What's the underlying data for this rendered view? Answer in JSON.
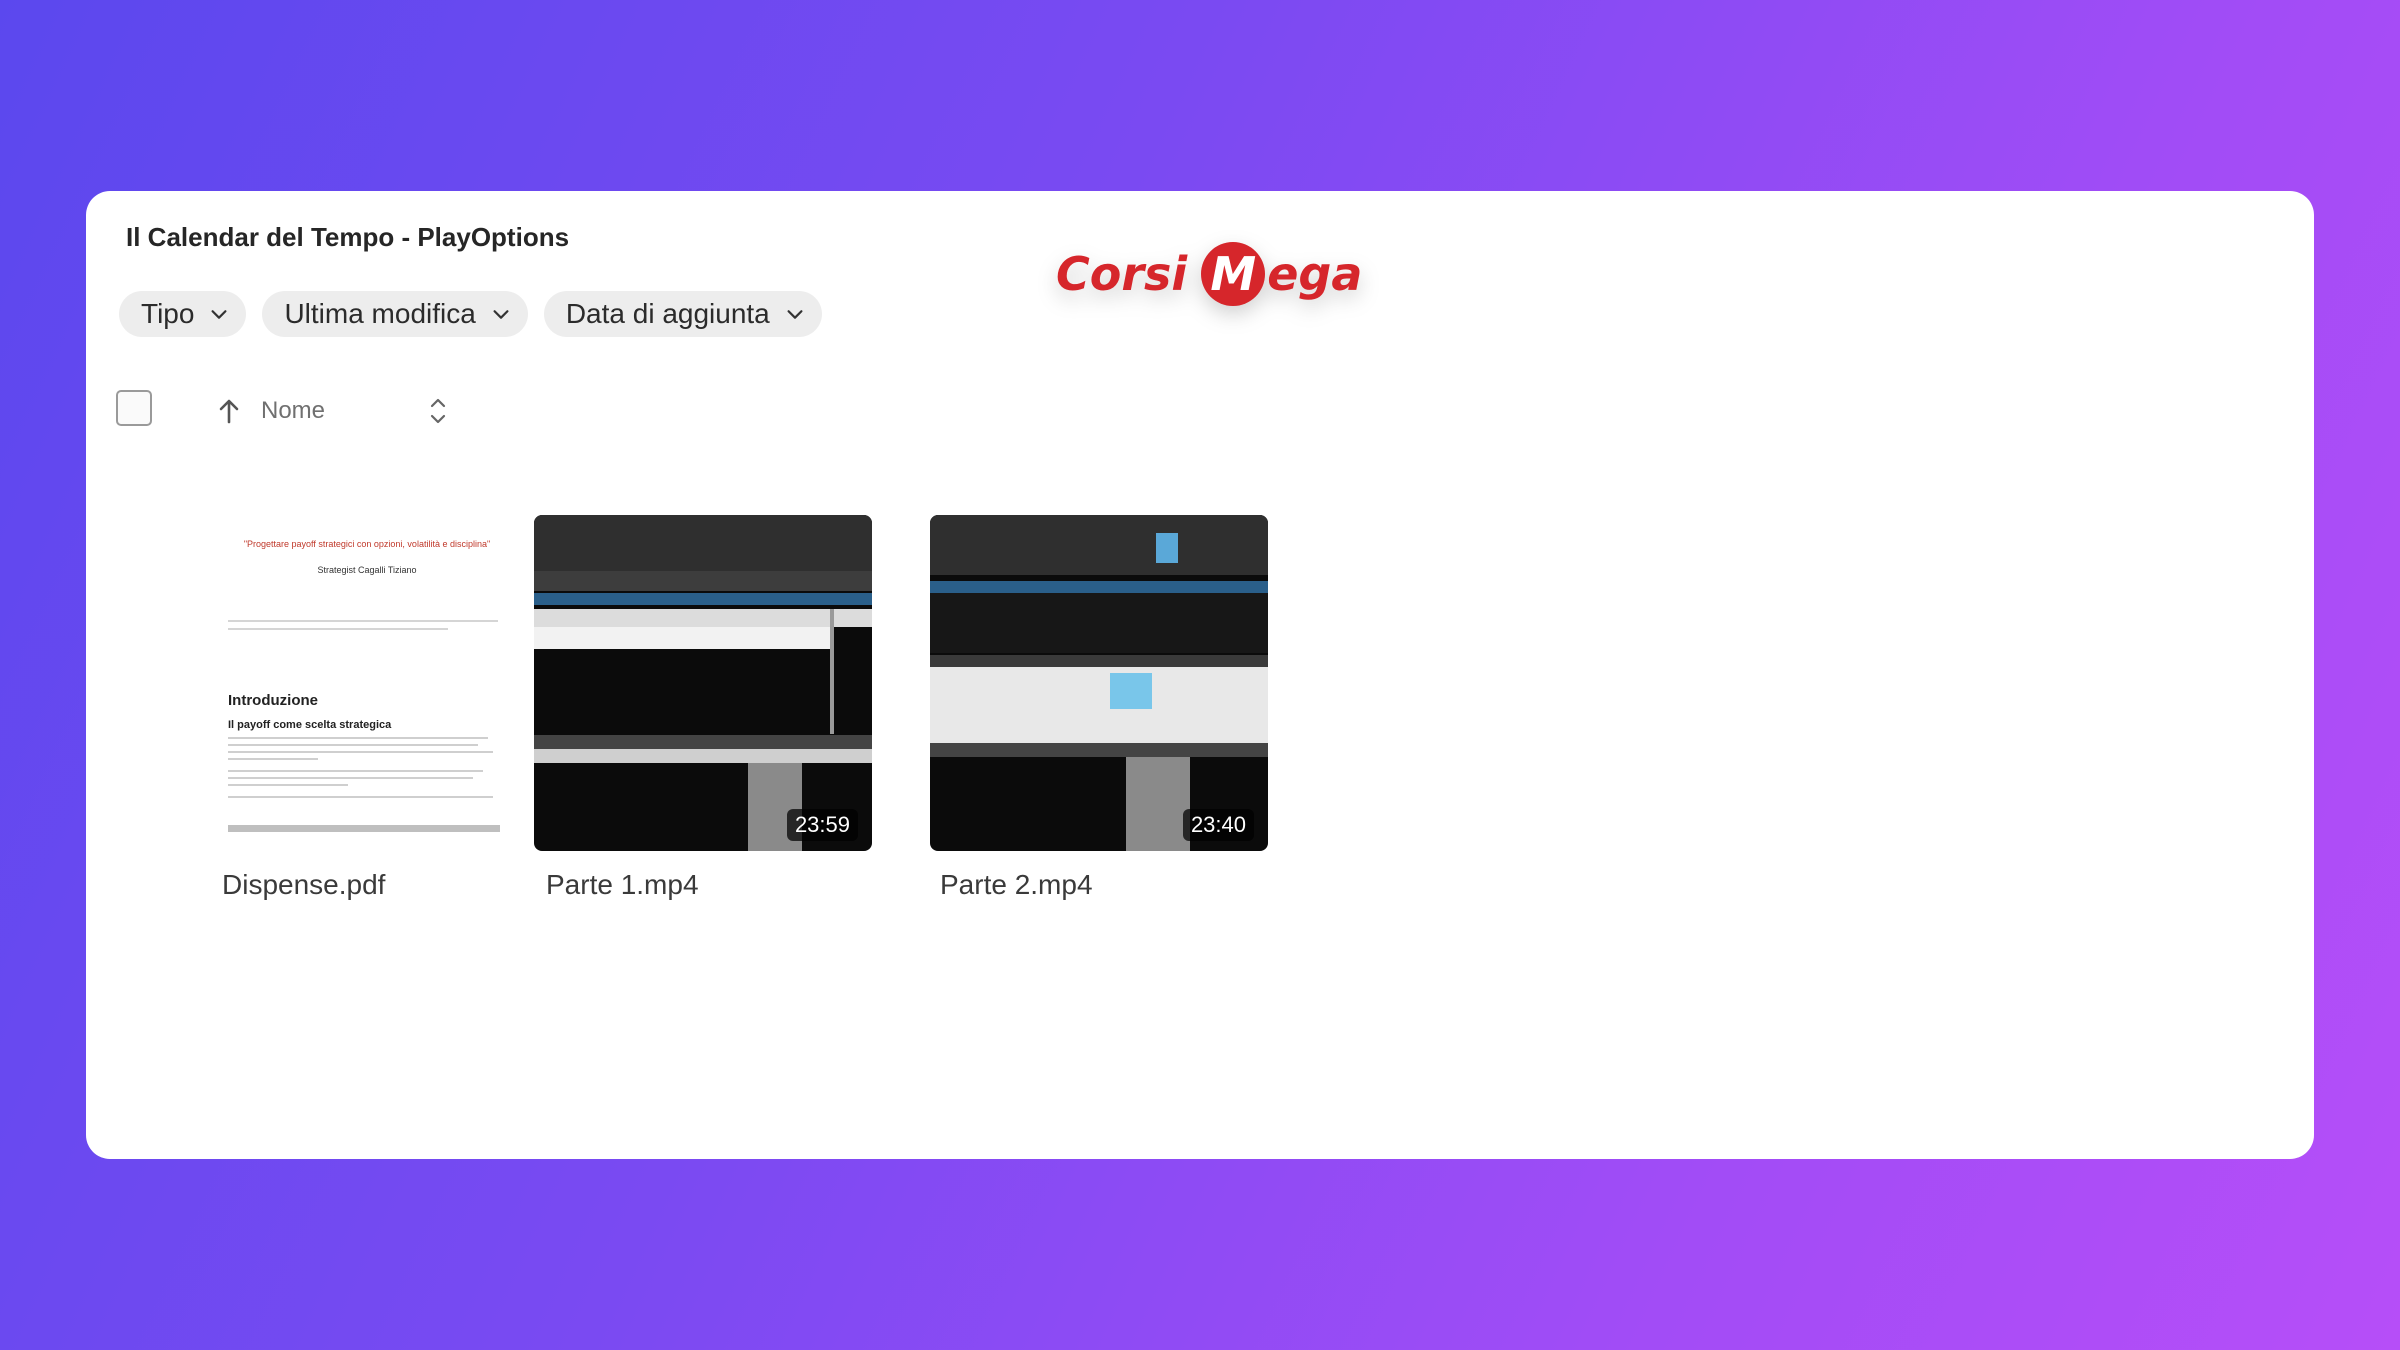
{
  "folder": {
    "title": "Il Calendar del Tempo - PlayOptions"
  },
  "logo": {
    "part1": "Corsi",
    "m": "M",
    "part2": "ega"
  },
  "filters": [
    {
      "label": "Tipo"
    },
    {
      "label": "Ultima modifica"
    },
    {
      "label": "Data di aggiunta"
    }
  ],
  "list_header": {
    "sort_column": "Nome"
  },
  "files": [
    {
      "name": "Dispense.pdf",
      "type": "pdf",
      "preview": {
        "line1": "\"Progettare payoff strategici con opzioni, volatilità e disciplina\"",
        "line2": "Strategist Cagalli Tiziano",
        "heading": "Introduzione",
        "subheading": "Il payoff come scelta strategica"
      }
    },
    {
      "name": "Parte 1.mp4",
      "type": "video",
      "duration": "23:59"
    },
    {
      "name": "Parte 2.mp4",
      "type": "video",
      "duration": "23:40"
    }
  ],
  "colors": {
    "accent": "#d6262b",
    "chip_bg": "#ededed"
  }
}
